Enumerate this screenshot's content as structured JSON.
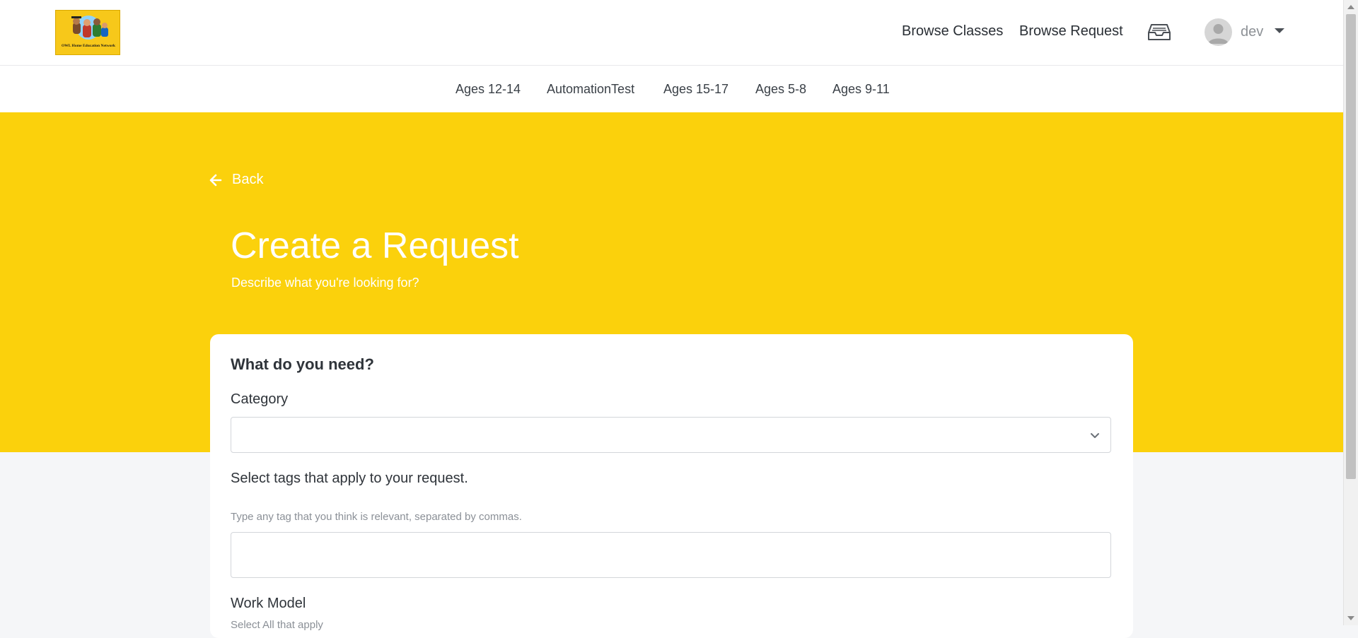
{
  "brand": {
    "logo_text": "OWL Home Education Network",
    "logo_icon": "school-kids-logo"
  },
  "topnav": {
    "browse_classes": "Browse Classes",
    "browse_request": "Browse Request",
    "inbox_icon": "inbox-icon",
    "username": "dev"
  },
  "categories": [
    "Ages 12-14",
    "AutomationTest",
    "Ages 15-17",
    "Ages 5-8",
    "Ages 9-11"
  ],
  "hero": {
    "back_label": "Back",
    "title": "Create a Request",
    "subtitle": "Describe what you're looking for?"
  },
  "form": {
    "heading": "What do you need?",
    "category_label": "Category",
    "category_value": "",
    "tags_label": "Select tags that apply to your request.",
    "tags_hint": "Type any tag that you think is relevant, separated by commas.",
    "tags_value": "",
    "work_model_label": "Work Model",
    "work_model_hint": "Select All that apply"
  },
  "colors": {
    "hero_yellow": "#fbd10c",
    "text_dark": "#2a2f35",
    "muted": "#8b9097"
  }
}
